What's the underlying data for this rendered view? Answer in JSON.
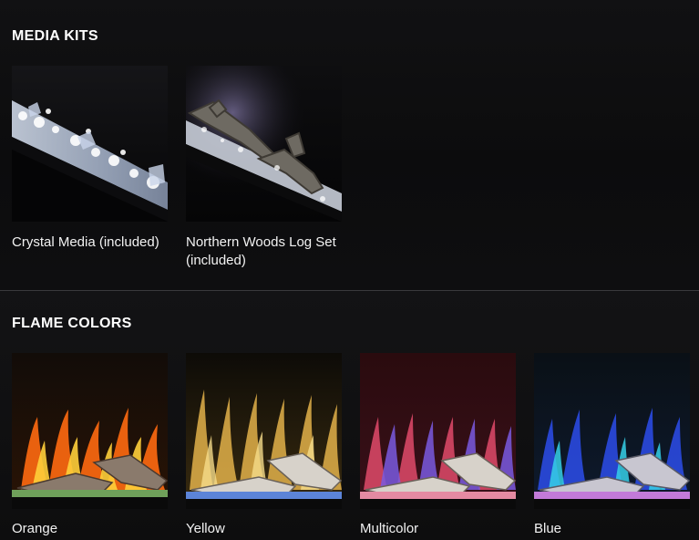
{
  "media_kits": {
    "heading": "MEDIA KITS",
    "items": [
      {
        "label": "Crystal Media (included)",
        "image": "crystal-media-photo"
      },
      {
        "label": "Northern Woods Log Set (included)",
        "image": "log-set-photo"
      }
    ]
  },
  "flame_colors": {
    "heading": "FLAME COLORS",
    "items": [
      {
        "label": "Orange",
        "image": "orange-flame-photo"
      },
      {
        "label": "Yellow",
        "image": "yellow-flame-photo"
      },
      {
        "label": "Multicolor",
        "image": "multicolor-flame-photo"
      },
      {
        "label": "Blue",
        "image": "blue-flame-photo"
      }
    ]
  }
}
